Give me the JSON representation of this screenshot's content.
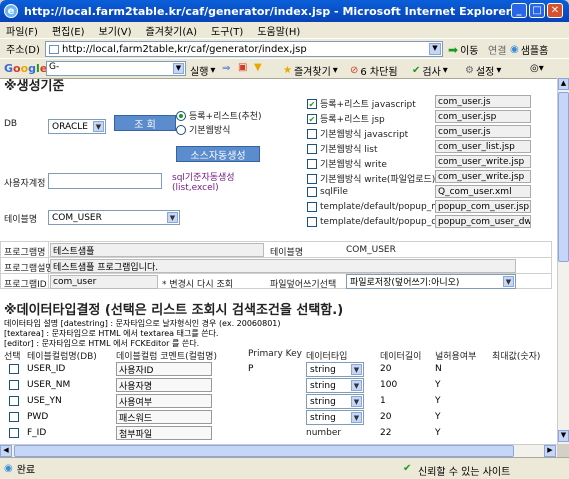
{
  "window": {
    "title": "http://local.farm2table.kr/caf/generator/index.jsp - Microsoft Internet Explorer"
  },
  "menu": [
    "파일(F)",
    "편집(E)",
    "보기(V)",
    "즐겨찾기(A)",
    "도구(T)",
    "도움말(H)"
  ],
  "address": {
    "label": "주소(D)",
    "url": "http://local,farm2table,kr/caf/generator/index,jsp",
    "go": "이동",
    "links": "연결",
    "sample": "샘플홈"
  },
  "google_bar": {
    "logo": "Google",
    "search_value": "G-",
    "run": "실행",
    "favorites": "즐겨찾기",
    "blocked": "6 차단됨",
    "check": "검사",
    "settings": "설정"
  },
  "section1": {
    "heading": "※생성기준",
    "db_label": "DB",
    "db_value": "ORACLE",
    "query_button": "조    회",
    "radio_list": "등록+리스트(추천)",
    "radio_basic": "기본웹방식",
    "autogen_button": "소스자동생성",
    "user_label": "사용자계정",
    "sql_link": "sql기준자동생성\n(list,excel)",
    "table_label": "테이블명",
    "table_value": "COM_USER"
  },
  "options": [
    {
      "checked": true,
      "label": "등록+리스트 javascript",
      "file": "com_user.js"
    },
    {
      "checked": true,
      "label": "등록+리스트 jsp",
      "file": "com_user.jsp"
    },
    {
      "checked": false,
      "label": "기본웹방식 javascript",
      "file": "com_user.js"
    },
    {
      "checked": false,
      "label": "기본웹방식 list",
      "file": "com_user_list.jsp"
    },
    {
      "checked": false,
      "label": "기본웹방식 write",
      "file": "com_user_write.jsp"
    },
    {
      "checked": false,
      "label": "기본웹방식 write(파일업로드)",
      "file": "com_user_write.jsp"
    },
    {
      "checked": false,
      "label": "sqlFile",
      "file": "Q_com_user.xml"
    },
    {
      "checked": false,
      "label": "template/default/popup_master.vm",
      "file": "popup_com_user.jsp"
    },
    {
      "checked": false,
      "label": "template/default/popup_detail.vm",
      "file": "popup_com_user_dw.js"
    }
  ],
  "program": {
    "name_label": "프로그램명",
    "name_value": "테스트샘플",
    "table_label": "테이블명",
    "table_value": "COM_USER",
    "desc_label": "프로그램설명",
    "desc_value": "테스트샘플 프로그램입니다.",
    "id_label": "프로그램ID",
    "id_value": "com_user",
    "id_note": "* 변경시 다시 조회",
    "overwrite_label": "파일덮어쓰기선택",
    "overwrite_value": "파일로저장(덮어쓰기:아니오)"
  },
  "section2": {
    "heading": "※데이터타입결정 (선택은 리스트 조회시 검색조건을 선택함.)",
    "note1": "데이터타입 설명 [datestring] : 문자타입으로 날자형식인 경우 (ex. 20060801)",
    "note2": "[textarea] : 문자타입으로 HTML 에서 textarea 태그를 쓴다.",
    "note3": "[editor] : 문자타입으로 HTML 에서 FCKEditor 를 쓴다."
  },
  "columns": [
    "선택",
    "테이블컬럼명(DB)",
    "데이블컬럼 코멘트(컬럼명)",
    "Primary Key",
    "데이터타입",
    "데이터길이",
    "널허용여부",
    "최대값(숫자)"
  ],
  "rows": [
    {
      "col": "USER_ID",
      "comment": "사용자ID",
      "pk": "P",
      "type": "string",
      "len": "20",
      "null": "N"
    },
    {
      "col": "USER_NM",
      "comment": "사용자명",
      "pk": "",
      "type": "string",
      "len": "100",
      "null": "Y"
    },
    {
      "col": "USE_YN",
      "comment": "사용여부",
      "pk": "",
      "type": "string",
      "len": "1",
      "null": "Y"
    },
    {
      "col": "PWD",
      "comment": "패스워드",
      "pk": "",
      "type": "string",
      "len": "20",
      "null": "Y"
    },
    {
      "col": "F_ID",
      "comment": "첨부파일",
      "pk": "",
      "type": "number",
      "len": "22",
      "null": "Y"
    }
  ],
  "status": {
    "left": "완료",
    "zone": "신뢰할 수 있는 사이트"
  },
  "colors": {
    "title_blue": "#0a5fd8",
    "button_blue": "#5b8ccd",
    "link_purple": "#7a1a8c"
  }
}
